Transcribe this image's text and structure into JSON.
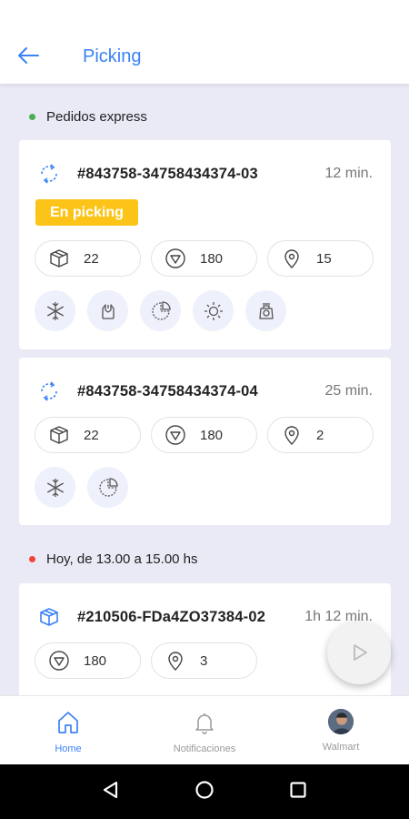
{
  "header": {
    "title": "Picking"
  },
  "sections": {
    "express": {
      "label": "Pedidos express",
      "dot_color": "#4caf50"
    },
    "scheduled": {
      "label": "Hoy, de 13.00 a 15.00 hs",
      "dot_color": "#f44336"
    }
  },
  "orders": [
    {
      "id": "#843758-34758434374-03",
      "time": "12 min.",
      "status": "En picking",
      "pills": {
        "boxes": "22",
        "weight": "180",
        "location": "15"
      },
      "icons": [
        "snowflake-icon",
        "hand-package-icon",
        "pie-icon",
        "sun-icon",
        "scale-icon"
      ]
    },
    {
      "id": "#843758-34758434374-04",
      "time": "25 min.",
      "pills": {
        "boxes": "22",
        "weight": "180",
        "location": "2"
      },
      "icons": [
        "snowflake-icon",
        "pie-icon"
      ]
    },
    {
      "id": "#210506-FDa4ZO37384-02",
      "time": "1h 12 min.",
      "pills": {
        "weight": "180",
        "location": "3"
      }
    }
  ],
  "nav": {
    "home": "Home",
    "notifications": "Notificaciones",
    "store": "Walmart"
  },
  "colors": {
    "accent": "#3b82f6",
    "badge": "#fcc419",
    "background": "#e9eaf6"
  }
}
